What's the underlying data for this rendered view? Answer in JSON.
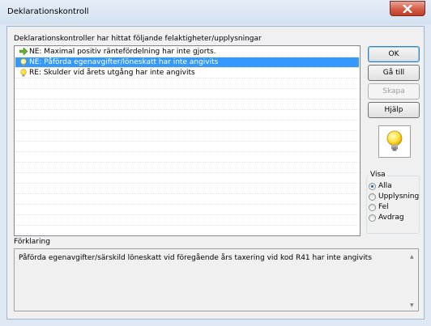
{
  "window": {
    "title": "Deklarationskontroll"
  },
  "list": {
    "heading": "Deklarationskontroller har hittat följande felaktigheter/upplysningar",
    "items": [
      {
        "text": "NE: Maximal positiv räntefördelning har inte gjorts.",
        "icon": "arrow-icon",
        "selected": false
      },
      {
        "text": "NE: Påförda egenavgifter/löneskatt har inte angivits",
        "icon": "lightbulb-icon",
        "selected": true
      },
      {
        "text": "RE: Skulder vid årets utgång har inte angivits",
        "icon": "lightbulb-icon",
        "selected": false
      }
    ]
  },
  "buttons": {
    "ok": "OK",
    "goto": "Gå till",
    "create": "Skapa",
    "help": "Hjälp"
  },
  "visa": {
    "legend": "Visa",
    "options": [
      {
        "label": "Alla",
        "checked": true
      },
      {
        "label": "Upplysning",
        "checked": false
      },
      {
        "label": "Fel",
        "checked": false
      },
      {
        "label": "Avdrag",
        "checked": false
      }
    ]
  },
  "explanation": {
    "label": "Förklaring",
    "text": "Påförda egenavgifter/särskild löneskatt vid föregående års taxering vid kod R41 har inte angivits"
  }
}
